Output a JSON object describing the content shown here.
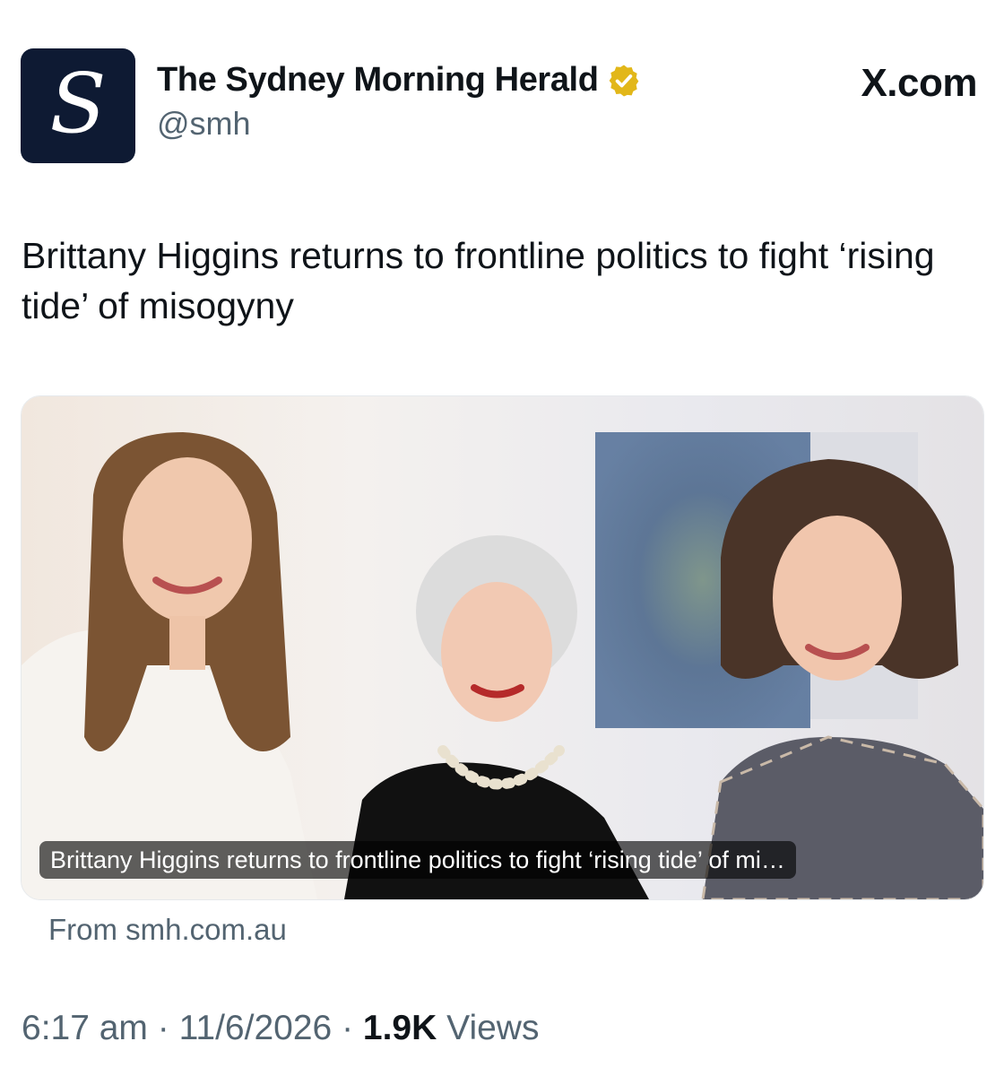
{
  "account": {
    "avatar_letter": "S",
    "display_name": "The Sydney Morning Herald",
    "handle": "@smh",
    "verified_icon": "gold-verified-badge-icon",
    "avatar_bg": "#0e1a33",
    "badge_color": "#e2b719"
  },
  "platform": {
    "label": "X.com"
  },
  "tweet": {
    "text": "Brittany Higgins returns to frontline politics to fight ‘rising tide’ of misogyny"
  },
  "card": {
    "caption": "Brittany Higgins returns to frontline politics to fight ‘rising tide’ of mi…",
    "source": "From smh.com.au",
    "image": "photo of three smiling women standing together"
  },
  "meta": {
    "time": "6:17 am",
    "separator": "·",
    "date": "11/6/2026",
    "views_count": "1.9K",
    "views_label": "Views"
  }
}
